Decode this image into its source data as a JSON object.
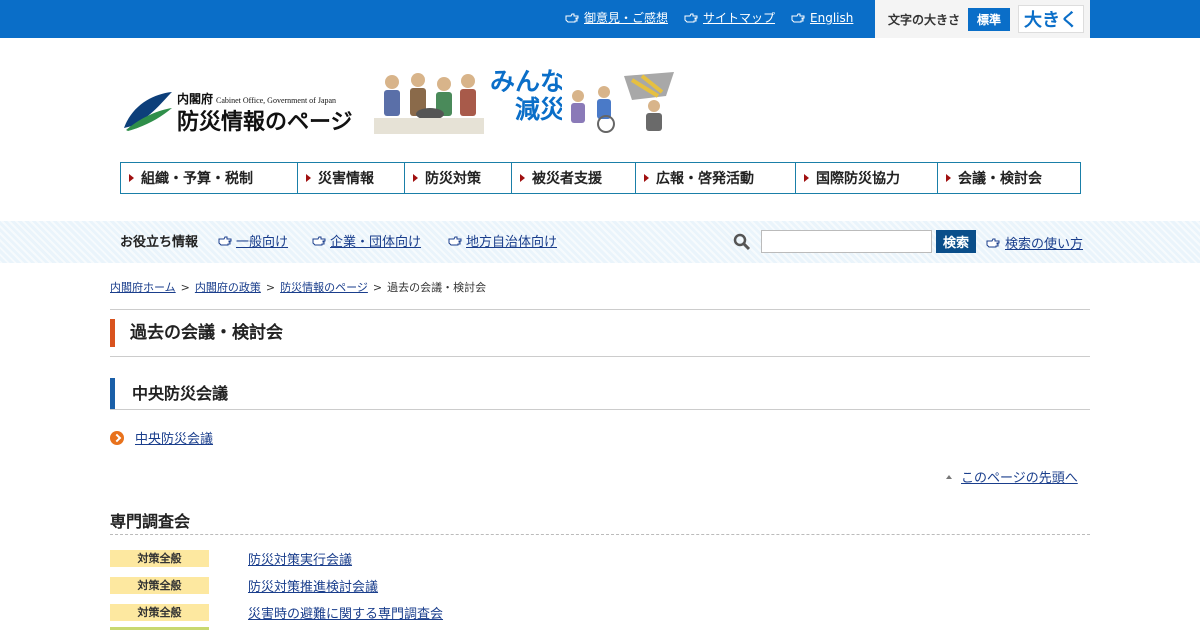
{
  "top_links": [
    {
      "label": "御意見・ご感想"
    },
    {
      "label": "サイトマップ"
    },
    {
      "label": "English"
    }
  ],
  "font_size": {
    "label": "文字の大きさ",
    "standard": "標準",
    "large": "大きく"
  },
  "logo": {
    "org_ja": "内閣府",
    "org_en": "Cabinet Office, Government of Japan",
    "site_title": "防災情報のページ",
    "catch_line1": "みんなで",
    "catch_line2": "減災"
  },
  "global_nav": [
    {
      "label": "組織・予算・税制"
    },
    {
      "label": "災害情報"
    },
    {
      "label": "防災対策"
    },
    {
      "label": "被災者支援"
    },
    {
      "label": "広報・啓発活動"
    },
    {
      "label": "国際防災協力"
    },
    {
      "label": "会議・検討会"
    }
  ],
  "helpful": {
    "title": "お役立ち情報",
    "links": [
      {
        "label": "一般向け"
      },
      {
        "label": "企業・団体向け"
      },
      {
        "label": "地方自治体向け"
      }
    ]
  },
  "search": {
    "placeholder": "",
    "button": "検索",
    "howto": "検索の使い方"
  },
  "breadcrumb": {
    "items": [
      "内閣府ホーム",
      "内閣府の政策",
      "防災情報のページ"
    ],
    "current": "過去の会議・検討会",
    "separator": ">"
  },
  "page_title": "過去の会議・検討会",
  "section1": {
    "heading": "中央防災会議",
    "link": "中央防災会議"
  },
  "to_top": "このページの先頭へ",
  "section2": {
    "heading": "専門調査会",
    "rows": [
      {
        "tag": "対策全般",
        "link": "防災対策実行会議"
      },
      {
        "tag": "対策全般",
        "link": "防災対策推進検討会議"
      },
      {
        "tag": "対策全般",
        "link": "災害時の避難に関する専門調査会"
      }
    ]
  },
  "colors": {
    "topbar": "#0a6ec8",
    "title_accent": "#d9531e",
    "section_accent": "#1a5fa8",
    "tag_bg": "#fde8a0",
    "nav_border": "#1a7fa8"
  }
}
